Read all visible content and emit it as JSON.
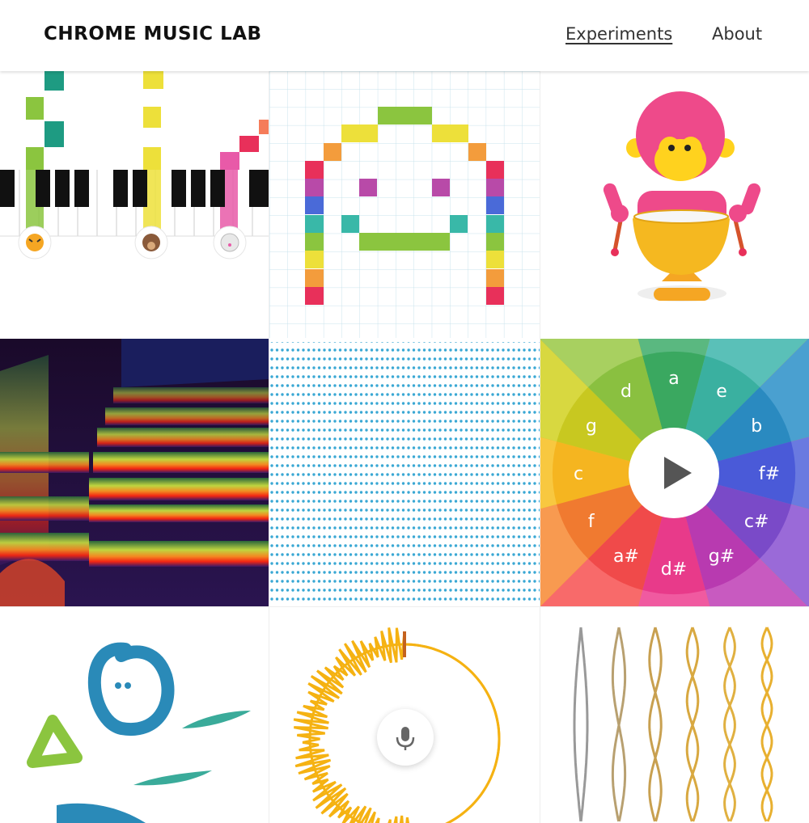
{
  "header": {
    "logo": "CHROME MUSIC LAB",
    "nav": [
      "Experiments",
      "About"
    ]
  },
  "experiments": [
    {
      "id": "shared-piano",
      "icon": "piano-animals-icon"
    },
    {
      "id": "song-maker",
      "icon": "pixel-face-icon"
    },
    {
      "id": "rhythm",
      "icon": "monkey-drummer-icon"
    },
    {
      "id": "spectrogram",
      "icon": "spectrogram-icon"
    },
    {
      "id": "sound-waves",
      "icon": "dot-grid-icon"
    },
    {
      "id": "chords",
      "icon": "color-wheel-icon",
      "wheel_notes": [
        "a",
        "e",
        "b",
        "f#",
        "c#",
        "g#",
        "d#",
        "a#",
        "f",
        "c",
        "g",
        "d"
      ]
    },
    {
      "id": "kandinsky",
      "icon": "kandinsky-shapes-icon"
    },
    {
      "id": "voice-spinner",
      "icon": "microphone-icon"
    },
    {
      "id": "strings",
      "icon": "vibrating-strings-icon"
    }
  ],
  "colors": {
    "accent_red": "#e8305a",
    "accent_yellow": "#ede03a",
    "accent_green": "#8bc53f",
    "accent_teal": "#1e9b82",
    "accent_blue": "#2aa8d8",
    "accent_orange": "#f5a623"
  }
}
